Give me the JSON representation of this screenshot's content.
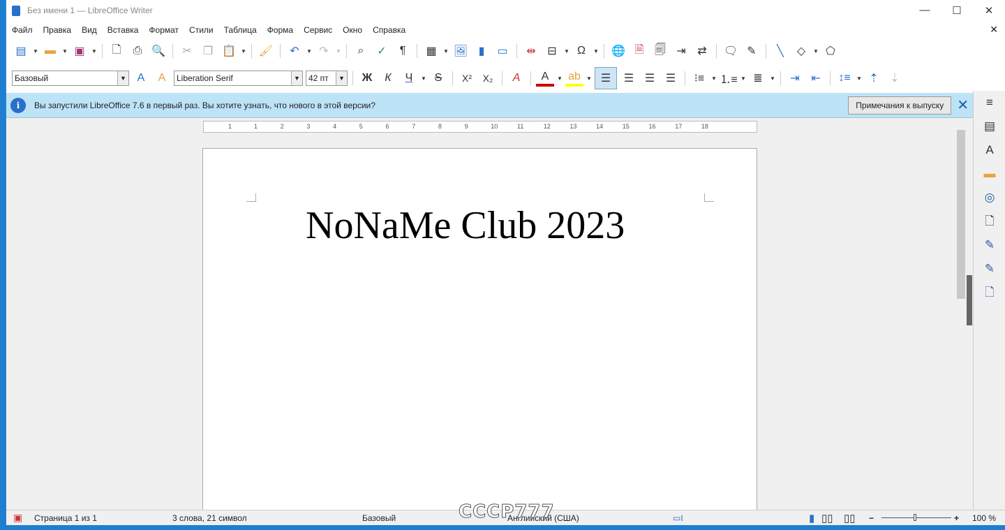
{
  "window": {
    "title": "Без имени 1 — LibreOffice Writer",
    "minimize": "—",
    "maximize": "☐",
    "close": "✕"
  },
  "menu": [
    "Файл",
    "Правка",
    "Вид",
    "Вставка",
    "Формат",
    "Стили",
    "Таблица",
    "Форма",
    "Сервис",
    "Окно",
    "Справка"
  ],
  "menu_close": "✕",
  "toolbar2": {
    "style": "Базовый",
    "font": "Liberation Serif",
    "size": "42 пт",
    "bold": "Ж",
    "italic": "К",
    "underline": "Ч",
    "strike": "S",
    "sup": "X²",
    "sub": "X₂"
  },
  "infobar": {
    "icon": "i",
    "message": "Вы запустили LibreOffice 7.6 в первый раз. Вы хотите узнать, что нового в этой версии?",
    "button": "Примечания к выпуску",
    "close": "✕"
  },
  "ruler": [
    "1",
    "1",
    "2",
    "3",
    "4",
    "5",
    "6",
    "7",
    "8",
    "9",
    "10",
    "11",
    "12",
    "13",
    "14",
    "15",
    "16",
    "17",
    "18"
  ],
  "document": {
    "text": "NoNaMe Club 2023"
  },
  "status": {
    "page": "Страница 1 из 1",
    "words": "3 слова, 21 символ",
    "style": "Базовый",
    "language": "Английский (США)",
    "zoom": "100 %",
    "zoom_minus": "−",
    "zoom_plus": "+",
    "zoom_level": 100
  },
  "watermark": "CCCP777"
}
